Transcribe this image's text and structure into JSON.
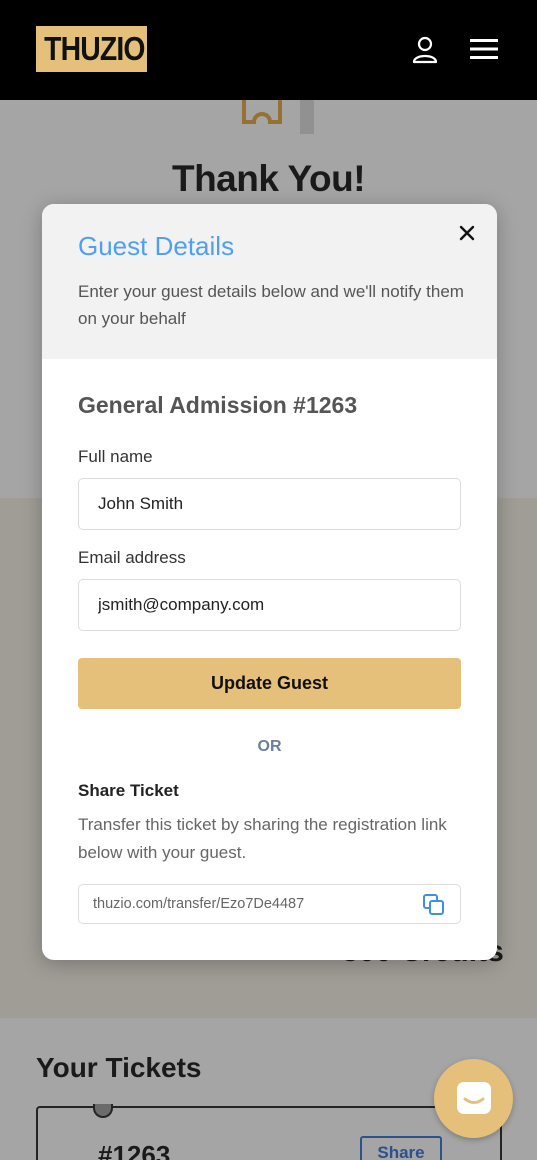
{
  "header": {
    "logo_text": "THUZIO",
    "icons": [
      "user-icon",
      "menu-icon"
    ]
  },
  "background": {
    "thank_you": "Thank You!",
    "credits_fragment": "500 Credits",
    "your_tickets": "Your Tickets",
    "ticket_number": "#1263",
    "share_label": "Share"
  },
  "modal": {
    "title": "Guest Details",
    "description": "Enter your guest details below and we'll notify them on your behalf",
    "section_title": "General Admission #1263",
    "full_name_label": "Full name",
    "full_name_value": "John Smith",
    "email_label": "Email address",
    "email_value": "jsmith@company.com",
    "update_button": "Update Guest",
    "or_text": "OR",
    "share_title": "Share Ticket",
    "share_description": "Transfer this ticket by sharing the registration link below with your guest.",
    "share_link": "thuzio.com/transfer/Ezo7De4487"
  },
  "colors": {
    "accent_gold": "#e5c07b",
    "title_blue": "#4fa0f0",
    "header_black": "#000000"
  }
}
